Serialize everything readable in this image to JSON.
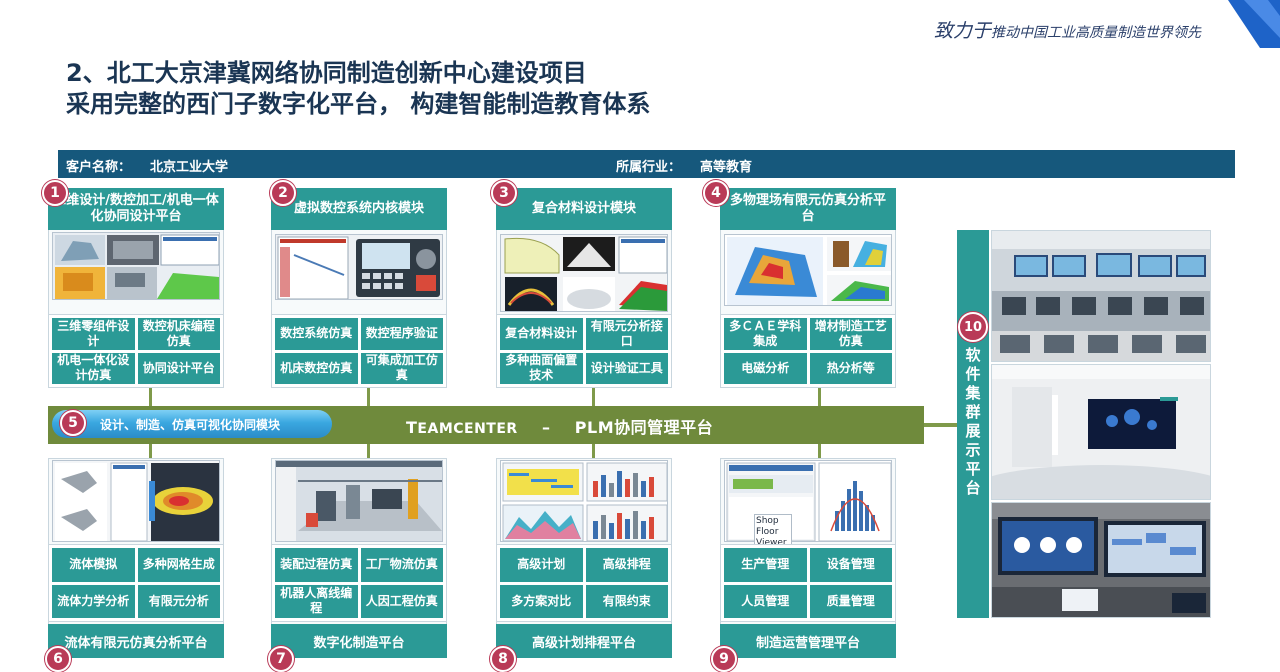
{
  "header": {
    "slogan_big": "致力于",
    "slogan_small": "推动中国工业高质量制造世界领先",
    "title_line1": "2、北工大京津冀网络协同制造创新中心建设项目",
    "title_line2": "采用完整的西门子数字化平台，  构建智能制造教育体系"
  },
  "info": {
    "customer_label": "客户名称：",
    "customer_value": "北京工业大学",
    "industry_label": "所属行业：",
    "industry_value": "高等教育"
  },
  "modules_top": [
    {
      "num": "1",
      "title": "三维设计/数控加工/机电一体化协同设计平台",
      "cells": [
        "三维零组件设计",
        "数控机床编程仿真",
        "机电一体化设计仿真",
        "协同设计平台"
      ]
    },
    {
      "num": "2",
      "title": "虚拟数控系统内核模块",
      "cells": [
        "数控系统仿真",
        "数控程序验证",
        "机床数控仿真",
        "可集成加工仿真"
      ]
    },
    {
      "num": "3",
      "title": "复合材料设计模块",
      "cells": [
        "复合材料设计",
        "有限元分析接口",
        "多种曲面偏置技术",
        "设计验证工具"
      ]
    },
    {
      "num": "4",
      "title": "多物理场有限元仿真分析平台",
      "cells": [
        "多ＣＡＥ学科集成",
        "增材制造工艺仿真",
        "电磁分析",
        "热分析等"
      ]
    }
  ],
  "plm": {
    "num": "5",
    "pipe_label": "设计、制造、仿真可视化协同模块",
    "platform_prefix_cap": "T",
    "platform_prefix_rest": "EAMCENTER",
    "platform_dash": "–",
    "platform_name": "PLM协同管理平台"
  },
  "modules_bottom": [
    {
      "num": "6",
      "title": "流体有限元仿真分析平台",
      "cells": [
        "流体模拟",
        "多种网格生成",
        "流体力学分析",
        "有限元分析"
      ]
    },
    {
      "num": "7",
      "title": "数字化制造平台",
      "cells": [
        "装配过程仿真",
        "工厂物流仿真",
        "机器人离线编程",
        "人因工程仿真"
      ]
    },
    {
      "num": "8",
      "title": "高级计划排程平台",
      "cells": [
        "高级计划",
        "高级排程",
        "多方案对比",
        "有限约束"
      ]
    },
    {
      "num": "9",
      "title": "制造运营管理平台",
      "cells": [
        "生产管理",
        "设备管理",
        "人员管理",
        "质量管理"
      ],
      "screenshot_label": "Shop Floor Viewer"
    }
  ],
  "side": {
    "num": "10",
    "label": "软件集群展示平台"
  },
  "colors": {
    "teal": "#2b9a96",
    "navy": "#16587c",
    "olive": "#6f8a3c",
    "badge": "#b93a57",
    "pipe": "#3aa7e0"
  }
}
